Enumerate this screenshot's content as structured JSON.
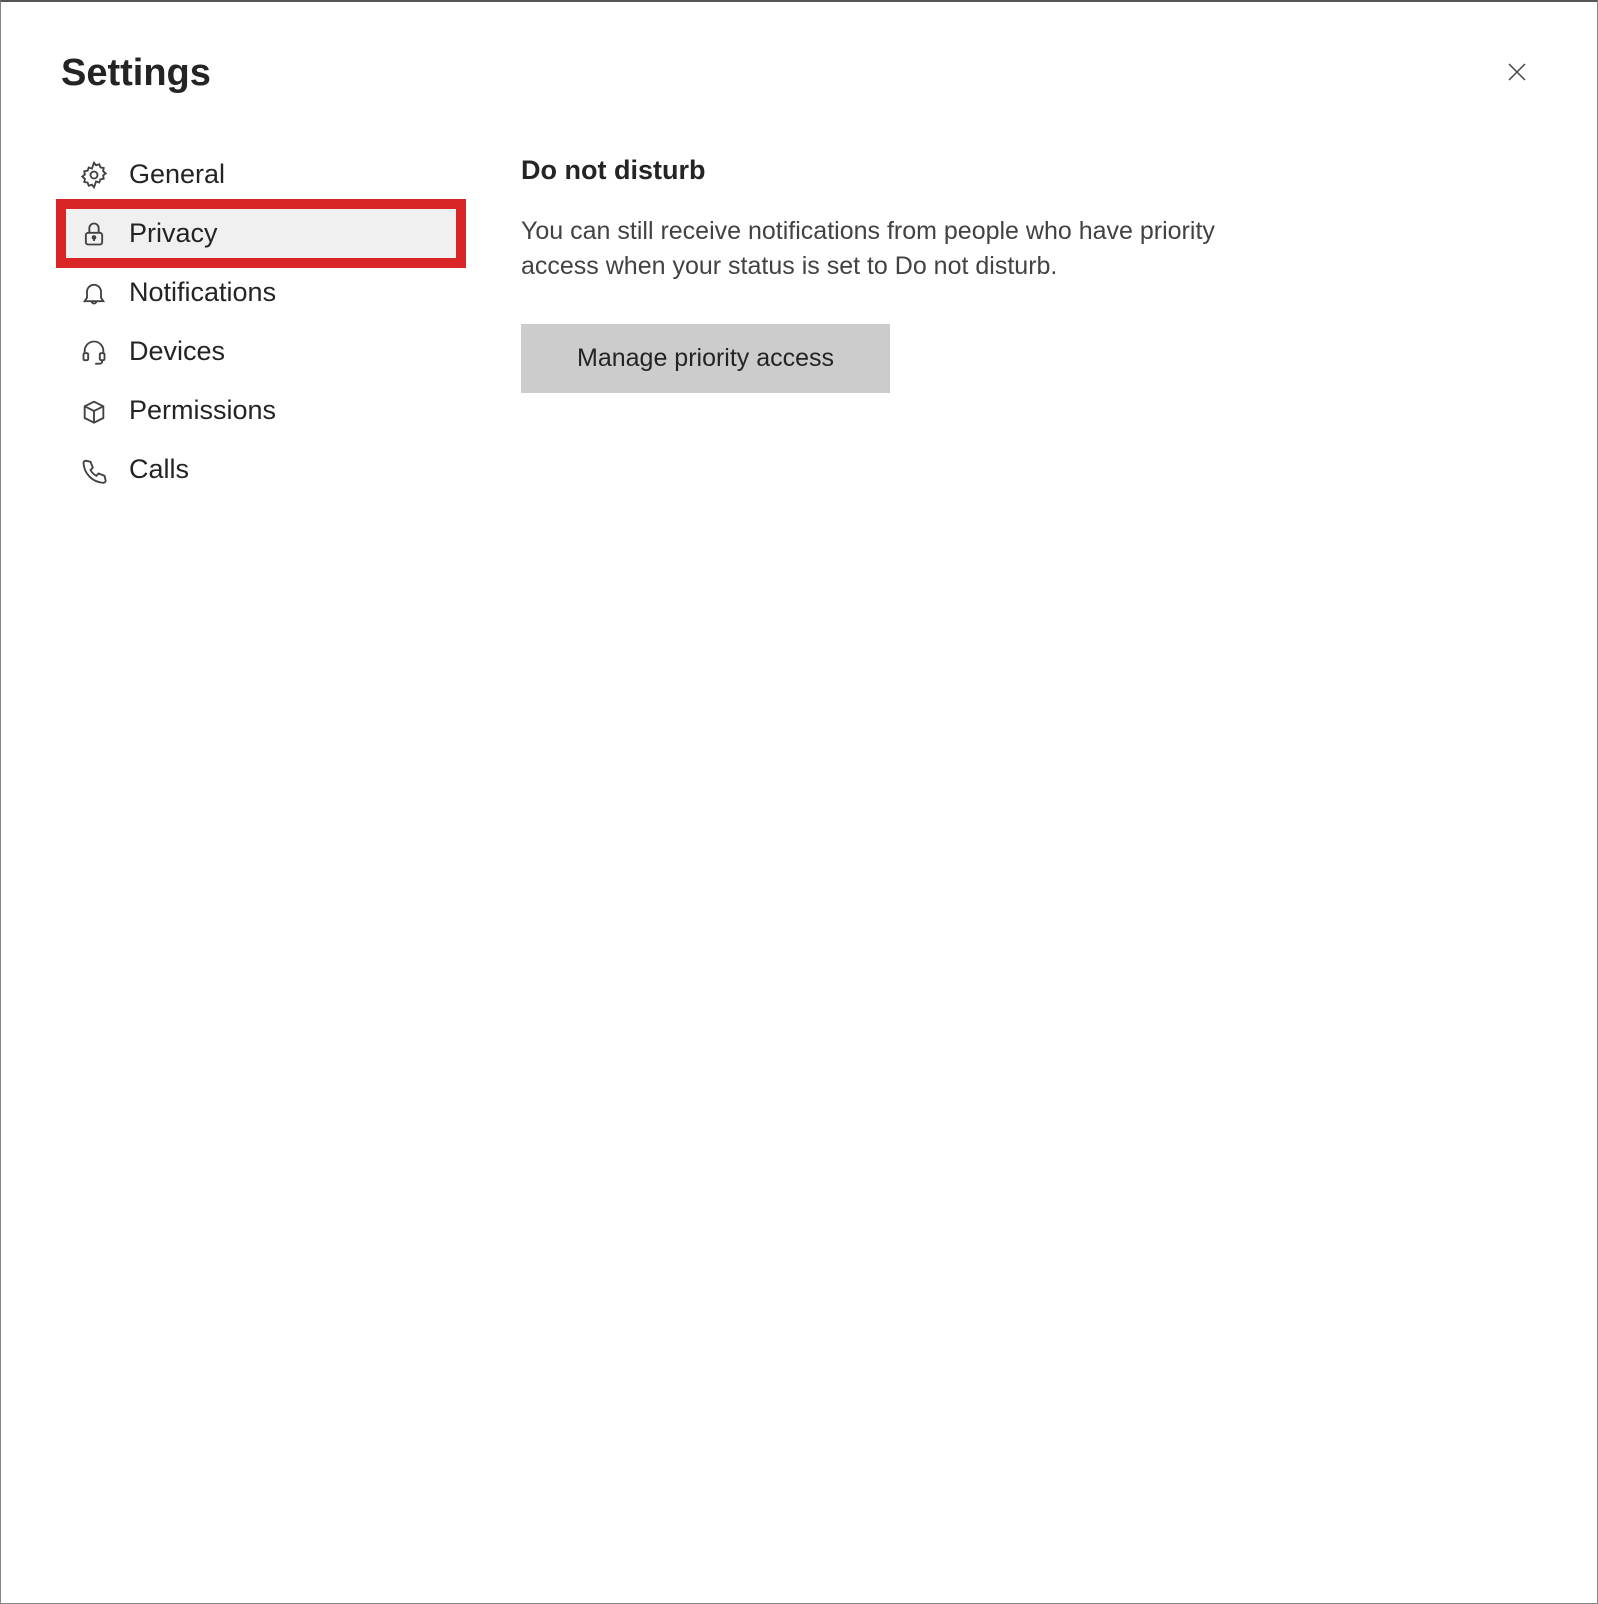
{
  "header": {
    "title": "Settings"
  },
  "sidebar": {
    "items": [
      {
        "label": "General",
        "icon": "gear-icon",
        "active": false
      },
      {
        "label": "Privacy",
        "icon": "lock-icon",
        "active": true
      },
      {
        "label": "Notifications",
        "icon": "bell-icon",
        "active": false
      },
      {
        "label": "Devices",
        "icon": "headset-icon",
        "active": false
      },
      {
        "label": "Permissions",
        "icon": "box-icon",
        "active": false
      },
      {
        "label": "Calls",
        "icon": "phone-icon",
        "active": false
      }
    ]
  },
  "main": {
    "section_title": "Do not disturb",
    "section_description": "You can still receive notifications from people who have priority access when your status is set to Do not disturb.",
    "action_button_label": "Manage priority access"
  }
}
